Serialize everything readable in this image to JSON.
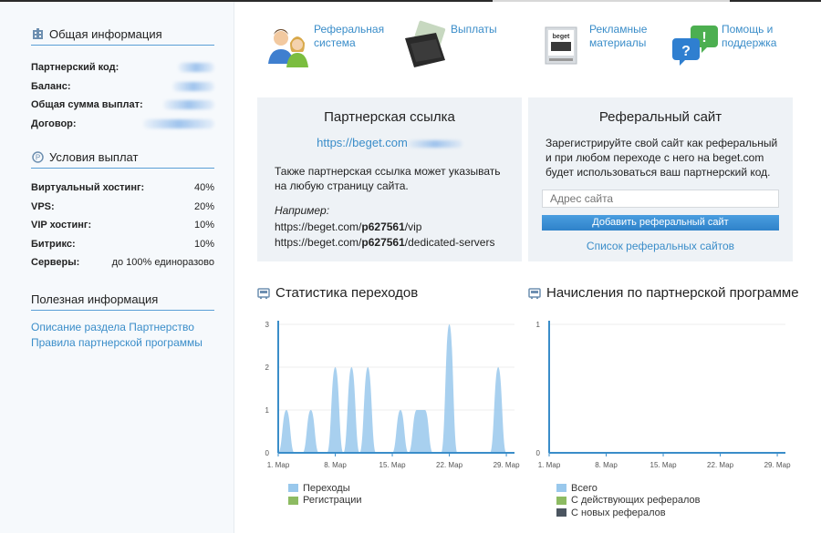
{
  "sidebar": {
    "general": {
      "title": "Общая информация",
      "rows": [
        {
          "label": "Партнерский код:"
        },
        {
          "label": "Баланс:"
        },
        {
          "label": "Общая сумма выплат:"
        },
        {
          "label": "Договор:"
        }
      ]
    },
    "payouts": {
      "title": "Условия выплат",
      "rows": [
        {
          "label": "Виртуальный хостинг:",
          "value": "40%"
        },
        {
          "label": "VPS:",
          "value": "20%"
        },
        {
          "label": "VIP хостинг:",
          "value": "10%"
        },
        {
          "label": "Битрикс:",
          "value": "10%"
        },
        {
          "label": "Серверы:",
          "value": "до 100% единоразово"
        }
      ]
    },
    "useful": {
      "title": "Полезная информация",
      "links": [
        "Описание раздела Партнерство",
        "Правила партнерской программы"
      ]
    }
  },
  "topnav": [
    {
      "icon": "users-icon",
      "label": "Реферальная система"
    },
    {
      "icon": "wallet-icon",
      "label": "Выплаты"
    },
    {
      "icon": "promo-materials-icon",
      "label": "Рекламные материалы"
    },
    {
      "icon": "help-bubbles-icon",
      "label": "Помощь и поддержка"
    }
  ],
  "partner_link": {
    "title": "Партнерская ссылка",
    "url": "https://beget.com",
    "text": "Также партнерская ссылка может указывать на любую страницу сайта.",
    "example_label": "Например:",
    "examples": [
      {
        "prefix": "https://beget.com/",
        "code": "p627561",
        "suffix": "/vip"
      },
      {
        "prefix": "https://beget.com/",
        "code": "p627561",
        "suffix": "/dedicated-servers"
      }
    ]
  },
  "ref_site": {
    "title": "Реферальный сайт",
    "text": "Зарегистрируйте свой сайт как реферальный и при любом переходе с него на beget.com будет использоваться ваш партнерский код.",
    "input_placeholder": "Адрес сайта",
    "button": "Добавить реферальный сайт",
    "list_link": "Список реферальных сайтов"
  },
  "colors": {
    "accent": "#3a8dc9",
    "series_blue": "#99c8ec",
    "series_green": "#8dbb62",
    "series_dark": "#4b5560"
  },
  "charts": {
    "stats_title": "Статистика переходов",
    "accruals_title": "Начисления по партнерской программе"
  },
  "chart_data": [
    {
      "type": "area",
      "x": [
        "1. Мар",
        "2. Мар",
        "3. Мар",
        "4. Мар",
        "5. Мар",
        "6. Мар",
        "7. Мар",
        "8. Мар",
        "9. Мар",
        "10. Мар",
        "11. Мар",
        "12. Мар",
        "13. Мар",
        "14. Мар",
        "15. Мар",
        "16. Мар",
        "17. Мар",
        "18. Мар",
        "19. Мар",
        "20. Мар",
        "21. Мар",
        "22. Мар",
        "23. Мар",
        "24. Мар",
        "25. Мар",
        "26. Мар",
        "27. Мар",
        "28. Мар",
        "29. Мар",
        "30. Мар"
      ],
      "tick_labels": [
        "1. Мар",
        "8. Мар",
        "15. Мар",
        "22. Мар",
        "29. Мар"
      ],
      "y_ticks": [
        0,
        1,
        2,
        3
      ],
      "ylim": [
        0,
        3
      ],
      "series": [
        {
          "name": "Переходы",
          "values": [
            0,
            1,
            0,
            0,
            1,
            0,
            0,
            2,
            0,
            2,
            0,
            2,
            0,
            0,
            0,
            1,
            0,
            1,
            1,
            0,
            0,
            3,
            0,
            0,
            0,
            0,
            0,
            2,
            0,
            0
          ]
        },
        {
          "name": "Регистрации",
          "values": [
            0,
            0,
            0,
            0,
            0,
            0,
            0,
            0,
            0,
            0,
            0,
            0,
            0,
            0,
            0,
            0,
            0,
            0,
            0,
            0,
            0,
            0,
            0,
            0,
            0,
            0,
            0,
            0,
            0,
            0
          ]
        }
      ]
    },
    {
      "type": "area",
      "x": [
        "1. Мар",
        "2. Мар",
        "3. Мар",
        "4. Мар",
        "5. Мар",
        "6. Мар",
        "7. Мар",
        "8. Мар",
        "9. Мар",
        "10. Мар",
        "11. Мар",
        "12. Мар",
        "13. Мар",
        "14. Мар",
        "15. Мар",
        "16. Мар",
        "17. Мар",
        "18. Мар",
        "19. Мар",
        "20. Мар",
        "21. Мар",
        "22. Мар",
        "23. Мар",
        "24. Мар",
        "25. Мар",
        "26. Мар",
        "27. Мар",
        "28. Мар",
        "29. Мар",
        "30. Мар"
      ],
      "tick_labels": [
        "1. Мар",
        "8. Мар",
        "15. Мар",
        "22. Мар",
        "29. Мар"
      ],
      "y_ticks": [
        0,
        1
      ],
      "ylim": [
        0,
        1
      ],
      "series": [
        {
          "name": "Всего",
          "values": [
            0,
            0,
            0,
            0,
            0,
            0,
            0,
            0,
            0,
            0,
            0,
            0,
            0,
            0,
            0,
            0,
            0,
            0,
            0,
            0,
            0,
            0,
            0,
            0,
            0,
            0,
            0,
            0,
            0,
            0
          ]
        },
        {
          "name": "С действующих рефералов",
          "values": [
            0,
            0,
            0,
            0,
            0,
            0,
            0,
            0,
            0,
            0,
            0,
            0,
            0,
            0,
            0,
            0,
            0,
            0,
            0,
            0,
            0,
            0,
            0,
            0,
            0,
            0,
            0,
            0,
            0,
            0
          ]
        },
        {
          "name": "С новых рефералов",
          "values": [
            0,
            0,
            0,
            0,
            0,
            0,
            0,
            0,
            0,
            0,
            0,
            0,
            0,
            0,
            0,
            0,
            0,
            0,
            0,
            0,
            0,
            0,
            0,
            0,
            0,
            0,
            0,
            0,
            0,
            0
          ]
        }
      ]
    }
  ]
}
